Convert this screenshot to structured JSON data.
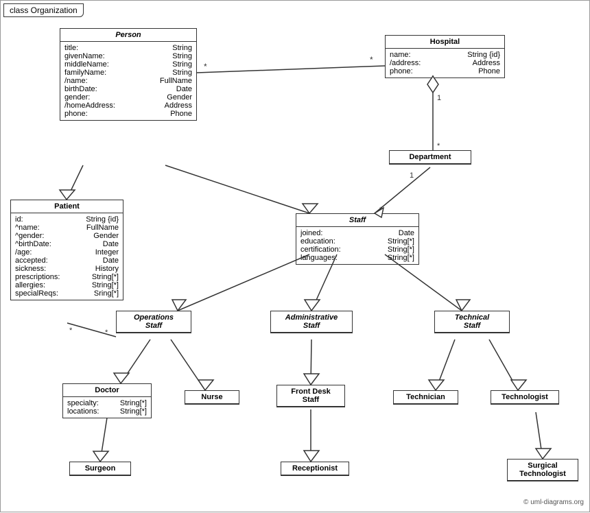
{
  "title": "class Organization",
  "classes": {
    "person": {
      "name": "Person",
      "italic": true,
      "fields": [
        {
          "name": "title:",
          "type": "String"
        },
        {
          "name": "givenName:",
          "type": "String"
        },
        {
          "name": "middleName:",
          "type": "String"
        },
        {
          "name": "familyName:",
          "type": "String"
        },
        {
          "name": "/name:",
          "type": "FullName"
        },
        {
          "name": "birthDate:",
          "type": "Date"
        },
        {
          "name": "gender:",
          "type": "Gender"
        },
        {
          "name": "/homeAddress:",
          "type": "Address"
        },
        {
          "name": "phone:",
          "type": "Phone"
        }
      ]
    },
    "hospital": {
      "name": "Hospital",
      "italic": false,
      "fields": [
        {
          "name": "name:",
          "type": "String {id}"
        },
        {
          "name": "/address:",
          "type": "Address"
        },
        {
          "name": "phone:",
          "type": "Phone"
        }
      ]
    },
    "department": {
      "name": "Department",
      "italic": false,
      "fields": []
    },
    "staff": {
      "name": "Staff",
      "italic": true,
      "fields": [
        {
          "name": "joined:",
          "type": "Date"
        },
        {
          "name": "education:",
          "type": "String[*]"
        },
        {
          "name": "certification:",
          "type": "String[*]"
        },
        {
          "name": "languages:",
          "type": "String[*]"
        }
      ]
    },
    "patient": {
      "name": "Patient",
      "italic": false,
      "fields": [
        {
          "name": "id:",
          "type": "String {id}"
        },
        {
          "name": "^name:",
          "type": "FullName"
        },
        {
          "name": "^gender:",
          "type": "Gender"
        },
        {
          "name": "^birthDate:",
          "type": "Date"
        },
        {
          "name": "/age:",
          "type": "Integer"
        },
        {
          "name": "accepted:",
          "type": "Date"
        },
        {
          "name": "sickness:",
          "type": "History"
        },
        {
          "name": "prescriptions:",
          "type": "String[*]"
        },
        {
          "name": "allergies:",
          "type": "String[*]"
        },
        {
          "name": "specialReqs:",
          "type": "Sring[*]"
        }
      ]
    },
    "operations_staff": {
      "name": "Operations\nStaff",
      "italic": true,
      "fields": []
    },
    "administrative_staff": {
      "name": "Administrative\nStaff",
      "italic": true,
      "fields": []
    },
    "technical_staff": {
      "name": "Technical\nStaff",
      "italic": true,
      "fields": []
    },
    "doctor": {
      "name": "Doctor",
      "italic": false,
      "fields": [
        {
          "name": "specialty:",
          "type": "String[*]"
        },
        {
          "name": "locations:",
          "type": "String[*]"
        }
      ]
    },
    "nurse": {
      "name": "Nurse",
      "italic": false,
      "fields": []
    },
    "front_desk_staff": {
      "name": "Front Desk\nStaff",
      "italic": false,
      "fields": []
    },
    "technician": {
      "name": "Technician",
      "italic": false,
      "fields": []
    },
    "technologist": {
      "name": "Technologist",
      "italic": false,
      "fields": []
    },
    "surgeon": {
      "name": "Surgeon",
      "italic": false,
      "fields": []
    },
    "receptionist": {
      "name": "Receptionist",
      "italic": false,
      "fields": []
    },
    "surgical_technologist": {
      "name": "Surgical\nTechnologist",
      "italic": false,
      "fields": []
    }
  },
  "watermark": "© uml-diagrams.org"
}
